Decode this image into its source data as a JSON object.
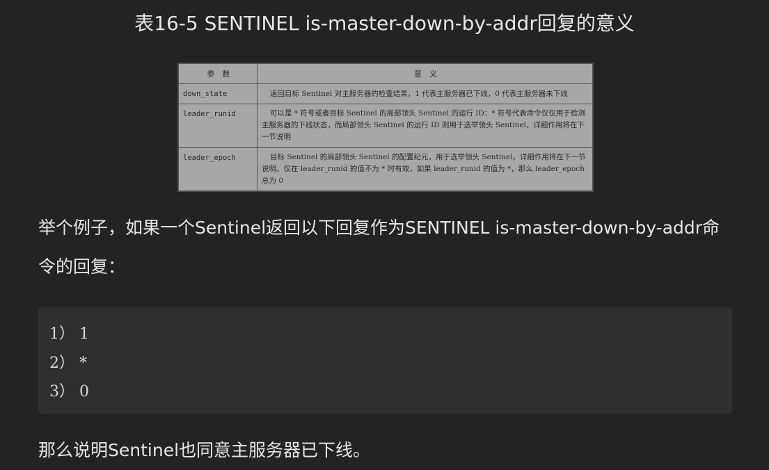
{
  "title": "表16-5 SENTINEL is-master-down-by-addr回复的意义",
  "table": {
    "headers": [
      "参　数",
      "意　义"
    ],
    "rows": [
      {
        "param": "down_state",
        "meaning": "返回目标 Sentinel 对主服务器的检查结果，1 代表主服务器已下线，0 代表主服务器未下线"
      },
      {
        "param": "leader_runid",
        "meaning": "可以是 * 符号或者目标 Sentinel 的局部领头 Sentinel 的运行 ID：* 符号代表命令仅仅用于检测主服务器的下线状态，而局部领头 Sentinel 的运行 ID 则用于选举领头 Sentinel，详细作用将在下一节说明"
      },
      {
        "param": "leader_epoch",
        "meaning": "目标 Sentinel 的局部领头 Sentinel 的配置纪元，用于选举领头 Sentinel，详细作用将在下一节说明。仅在 leader_runid 的值不为 * 时有效，如果 leader_runid 的值为 *，那么 leader_epoch 总为 0"
      }
    ]
  },
  "paragraph1": "举个例子，如果一个Sentinel返回以下回复作为SENTINEL is-master-down-by-addr命令的回复：",
  "code_lines": [
    "1） 1",
    "2） *",
    "3） 0"
  ],
  "paragraph2": "那么说明Sentinel也同意主服务器已下线。"
}
